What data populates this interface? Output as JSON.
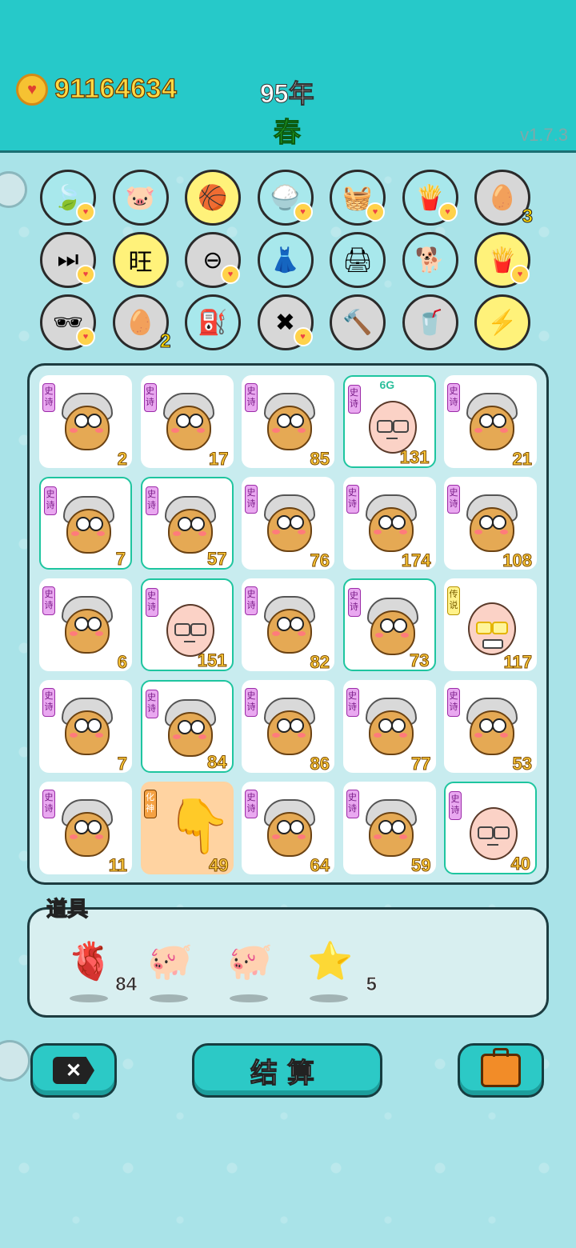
{
  "header": {
    "coins": "91164634",
    "year": "95年",
    "season": "春",
    "version": "v1.7.3"
  },
  "items_row1": [
    {
      "icon": "leaf-icon",
      "glyph": "🍃",
      "bg": "#a8e8ec",
      "heart": true
    },
    {
      "icon": "piggy-bank-icon",
      "glyph": "🐷",
      "bg": "#a8e8ec",
      "heart": false
    },
    {
      "icon": "basketballs-icon",
      "glyph": "🏀",
      "bg": "#fff27a",
      "heart": false
    },
    {
      "icon": "rice-bowl-icon",
      "glyph": "🍚",
      "bg": "#a8e8ec",
      "heart": true
    },
    {
      "icon": "fruit-basket-icon",
      "glyph": "🧺",
      "bg": "#a8e8ec",
      "heart": true
    },
    {
      "icon": "french-fries-icon",
      "glyph": "🍟",
      "bg": "#a8e8ec",
      "heart": true
    },
    {
      "icon": "egg-tray-icon",
      "glyph": "🥚",
      "bg": "#d7d7d7",
      "heart": false,
      "count": "3"
    }
  ],
  "items_row2": [
    {
      "icon": "skip-icon",
      "glyph": "⏭",
      "bg": "#d7d7d7",
      "heart": true
    },
    {
      "icon": "wang-tiles-icon",
      "glyph": "旺",
      "bg": "#fff27a",
      "heart": false
    },
    {
      "icon": "minus-icon",
      "glyph": "⊖",
      "bg": "#d7d7d7",
      "heart": true
    },
    {
      "icon": "skirt-icon",
      "glyph": "👗",
      "bg": "#a8e8ec",
      "heart": false
    },
    {
      "icon": "printer-icon",
      "glyph": "🖨",
      "bg": "#a8e8ec",
      "heart": false
    },
    {
      "icon": "dog-icon",
      "glyph": "🐕",
      "bg": "#a8e8ec",
      "heart": false
    },
    {
      "icon": "french-fries-icon",
      "glyph": "🍟",
      "bg": "#fff27a",
      "heart": true
    }
  ],
  "items_row3": [
    {
      "icon": "sunglasses-icon",
      "glyph": "🕶",
      "bg": "#d7d7d7",
      "heart": true
    },
    {
      "icon": "egg-tray-icon",
      "glyph": "🥚",
      "bg": "#d7d7d7",
      "heart": false,
      "count": "2"
    },
    {
      "icon": "pump-icon",
      "glyph": "⛽",
      "bg": "#a8e8ec",
      "heart": false
    },
    {
      "icon": "delete-tag-icon",
      "glyph": "✖",
      "bg": "#d7d7d7",
      "heart": true
    },
    {
      "icon": "hammer-icon",
      "glyph": "🔨",
      "bg": "#d7d7d7",
      "heart": false
    },
    {
      "icon": "milk-tea-icon",
      "glyph": "🥤",
      "bg": "#d7d7d7",
      "heart": false
    },
    {
      "icon": "lightning-icon",
      "glyph": "⚡",
      "bg": "#fff27a",
      "heart": false
    }
  ],
  "board": [
    {
      "type": "owl",
      "tag": "史诗",
      "num": "2",
      "hl": false
    },
    {
      "type": "owl",
      "tag": "史诗",
      "num": "17",
      "hl": false
    },
    {
      "type": "owl",
      "tag": "史诗",
      "num": "85",
      "hl": false
    },
    {
      "type": "face",
      "tag": "史诗",
      "num": "131",
      "hl": true,
      "badge": "6G"
    },
    {
      "type": "owl",
      "tag": "史诗",
      "num": "21",
      "hl": false
    },
    {
      "type": "owl",
      "tag": "史诗",
      "num": "7",
      "hl": true
    },
    {
      "type": "owl",
      "tag": "史诗",
      "num": "57",
      "hl": true
    },
    {
      "type": "owl",
      "tag": "史诗",
      "num": "76",
      "hl": false
    },
    {
      "type": "owl",
      "tag": "史诗",
      "num": "174",
      "hl": false
    },
    {
      "type": "owl",
      "tag": "史诗",
      "num": "108",
      "hl": false
    },
    {
      "type": "owl",
      "tag": "史诗",
      "num": "6",
      "hl": false
    },
    {
      "type": "face",
      "tag": "史诗",
      "num": "151",
      "hl": true
    },
    {
      "type": "owl",
      "tag": "史诗",
      "num": "82",
      "hl": false
    },
    {
      "type": "owl",
      "tag": "史诗",
      "num": "73",
      "hl": true
    },
    {
      "type": "goldface",
      "tag": "传说",
      "num": "117",
      "hl": false,
      "tagColor": "yellow"
    },
    {
      "type": "owl",
      "tag": "史诗",
      "num": "7",
      "hl": false
    },
    {
      "type": "owl",
      "tag": "史诗",
      "num": "84",
      "hl": true
    },
    {
      "type": "owl",
      "tag": "史诗",
      "num": "86",
      "hl": false
    },
    {
      "type": "owl",
      "tag": "史诗",
      "num": "77",
      "hl": false
    },
    {
      "type": "owl",
      "tag": "史诗",
      "num": "53",
      "hl": false
    },
    {
      "type": "owl",
      "tag": "史诗",
      "num": "11",
      "hl": false
    },
    {
      "type": "hand",
      "tag": "化神",
      "num": "49",
      "hl": false,
      "tagColor": "orange"
    },
    {
      "type": "owl",
      "tag": "史诗",
      "num": "64",
      "hl": false
    },
    {
      "type": "owl",
      "tag": "史诗",
      "num": "59",
      "hl": false
    },
    {
      "type": "face",
      "tag": "史诗",
      "num": "40",
      "hl": true
    }
  ],
  "props": {
    "label": "道具",
    "items": [
      {
        "icon": "liver-icon",
        "glyph": "🫀",
        "count": "84"
      },
      {
        "icon": "piggy-bank-icon",
        "glyph": "🐖",
        "count": ""
      },
      {
        "icon": "piggy-bank-icon",
        "glyph": "🐖",
        "count": ""
      },
      {
        "icon": "star-icon",
        "glyph": "⭐",
        "count": "5"
      }
    ]
  },
  "buttons": {
    "settle_label": "结算",
    "close_glyph": "✕"
  }
}
